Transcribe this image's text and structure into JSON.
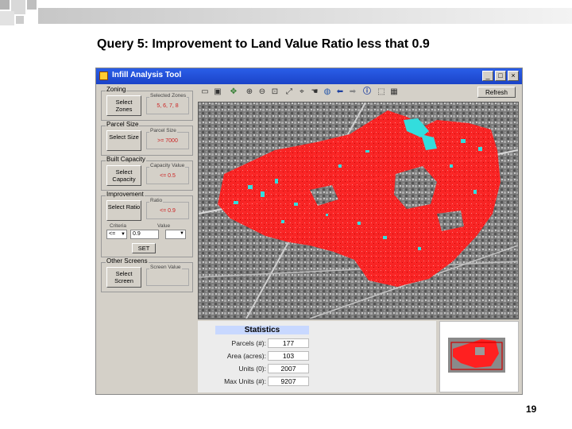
{
  "slide": {
    "title": "Query 5: Improvement to Land Value Ratio less that 0.9",
    "page_number": "19"
  },
  "window": {
    "title": "Infill Analysis Tool",
    "controls": {
      "minimize": "_",
      "maximize": "□",
      "close": "×"
    }
  },
  "panel": {
    "zoning": {
      "group_label": "Zoning",
      "button_label": "Select Zones",
      "value_label": "Selected Zones",
      "value": "5, 6, 7, 8"
    },
    "parcel_size": {
      "group_label": "Parcel Size",
      "button_label": "Select Size",
      "value_label": "Parcel Size",
      "value": ">= 7000"
    },
    "built_capacity": {
      "group_label": "Built Capacity",
      "button_label": "Select Capacity",
      "value_label": "Capacity Value",
      "value": "<= 0.5"
    },
    "improvement": {
      "group_label": "Improvement",
      "button_label": "Select Ratio",
      "value_label": "Ratio",
      "value": "<= 0.9",
      "operator_label": "Criteria",
      "operator_value": "<=",
      "input_label": "Value",
      "input_value": "0.9",
      "set_label": "SET"
    },
    "other": {
      "group_label": "Other Screens",
      "button_label": "Select Screen",
      "value_label": "Screen Value",
      "value": ""
    }
  },
  "toolbar": {
    "refresh_label": "Refresh",
    "icons": [
      "open-icon",
      "save-icon",
      "pan-icon",
      "zoom-in-icon",
      "zoom-out-icon",
      "zoom-region-icon",
      "full-extent-icon",
      "hand-icon",
      "globe-icon",
      "back-icon",
      "forward-icon",
      "info-icon",
      "select-icon",
      "clear-icon"
    ]
  },
  "stats": {
    "title": "Statistics",
    "rows": [
      {
        "label": "Parcels (#):",
        "value": "177"
      },
      {
        "label": "Area (acres):",
        "value": "103"
      },
      {
        "label": "Units (0):",
        "value": "2007"
      },
      {
        "label": "Max Units (#):",
        "value": "9207"
      }
    ]
  },
  "colors": {
    "selected_parcels": "#ff2020",
    "highlighted_parcels": "#33dddd",
    "titlebar": "#1b43c8",
    "panel_value": "#cc2222"
  }
}
